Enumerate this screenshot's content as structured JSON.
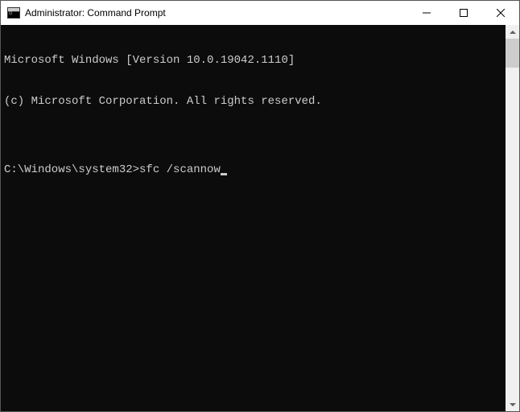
{
  "window": {
    "title": "Administrator: Command Prompt"
  },
  "terminal": {
    "lines": [
      "Microsoft Windows [Version 10.0.19042.1110]",
      "(c) Microsoft Corporation. All rights reserved.",
      ""
    ],
    "prompt": "C:\\Windows\\system32>",
    "command": "sfc /scannow"
  }
}
